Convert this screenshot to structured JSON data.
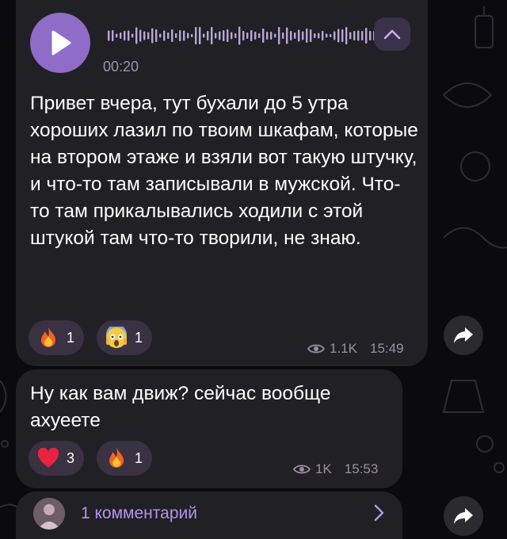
{
  "voice_message": {
    "duration": "00:20",
    "text": "Привет вчера, тут бухали до 5 утра хороших лазил по твоим шкафам, которые на втором этаже и взяли вот такую штучку, и что-то там записывали в мужской. Что-то там прикалывались ходили с этой штукой там что-то творили, не знаю.",
    "reactions": [
      {
        "icon": "fire-emoji",
        "count": "1"
      },
      {
        "icon": "scream-emoji",
        "count": "1"
      }
    ],
    "views": "1.1K",
    "time": "15:49"
  },
  "text_message": {
    "text": "Ну как вам движ? сейчас вообще ахуеете",
    "reactions": [
      {
        "icon": "heart-emoji",
        "count": "3"
      },
      {
        "icon": "fire-emoji",
        "count": "1"
      }
    ],
    "views": "1K",
    "time": "15:53"
  },
  "comments": {
    "label": "1 комментарий"
  },
  "colors": {
    "background": "#0b0a0e",
    "bubble": "#212024",
    "accent": "#8f6cc7",
    "link": "#b693f0",
    "meta": "#9a919f",
    "reaction_pill": "#3a3143"
  }
}
